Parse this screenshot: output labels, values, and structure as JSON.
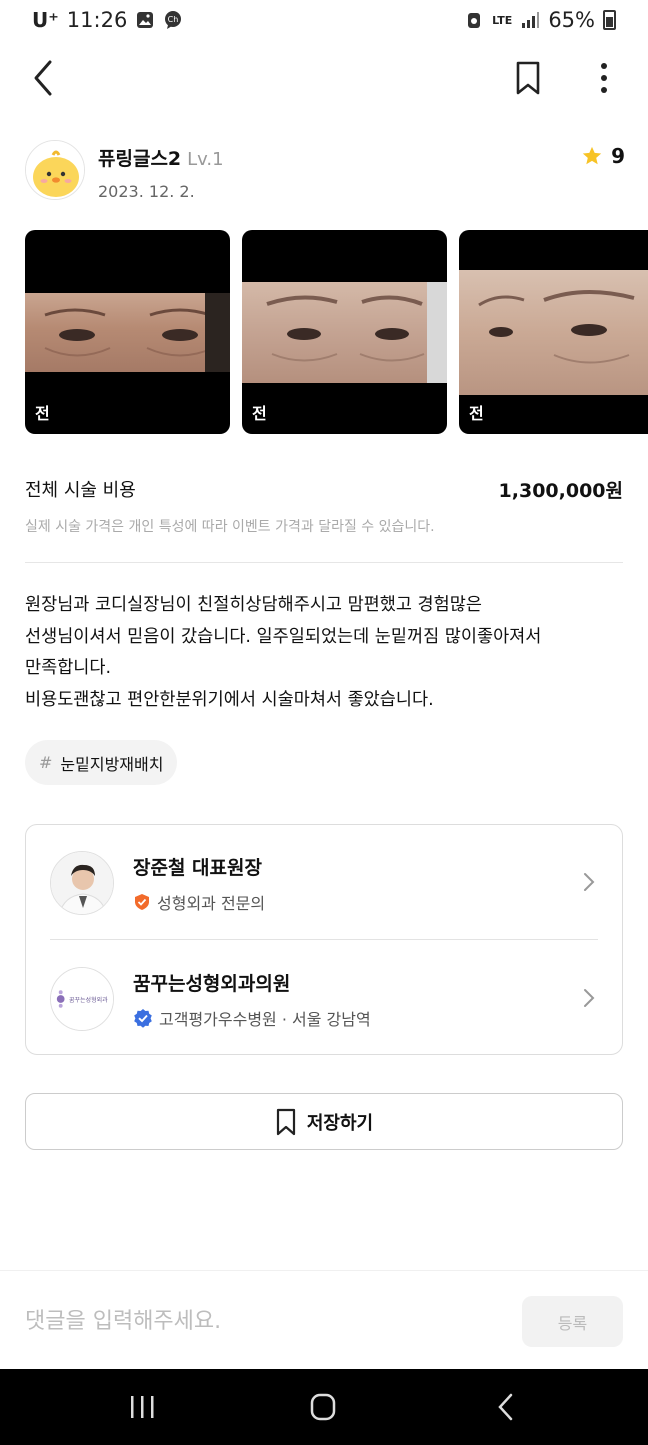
{
  "status_bar": {
    "carrier": "U⁺",
    "time": "11:26",
    "network": "LTE",
    "battery": "65%"
  },
  "author": {
    "name": "퓨링글스2",
    "level": "Lv.1",
    "date": "2023. 12. 2.",
    "rating": "9"
  },
  "photos": [
    {
      "caption": "전"
    },
    {
      "caption": "전"
    },
    {
      "caption": "전"
    }
  ],
  "cost": {
    "label": "전체 시술 비용",
    "value": "1,300,000원",
    "note": "실제 시술 가격은 개인 특성에 따라 이벤트 가격과 달라질 수 있습니다."
  },
  "review": {
    "text": "원장님과 코디실장님이 친절히상담해주시고 맘편했고 경험많은\n선생님이셔서 믿음이 갔습니다. 일주일되었는데 눈밑꺼짐 많이좋아져서\n만족합니다.\n비용도괜찮고 편안한분위기에서 시술마쳐서 좋았습니다."
  },
  "tag": {
    "hash": "#",
    "label": "눈밑지방재배치"
  },
  "doctor": {
    "name": "장준철 대표원장",
    "specialty": "성형외과 전문의"
  },
  "clinic": {
    "name": "꿈꾸는성형외과의원",
    "logo_text": "꿈꾸는성형외과",
    "info": "고객평가우수병원 · 서울 강남역"
  },
  "save_button": {
    "label": "저장하기"
  },
  "comment": {
    "placeholder": "댓글을 입력해주세요.",
    "submit_label": "등록"
  },
  "colors": {
    "star": "#F7C326",
    "specialist_badge": "#F26B2B",
    "verified_badge": "#3B6FE0"
  }
}
